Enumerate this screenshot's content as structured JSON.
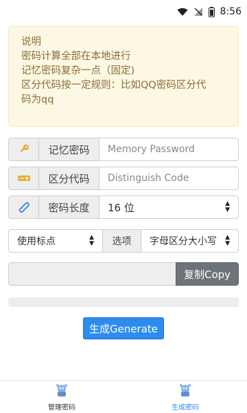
{
  "status_bar": {
    "time": "8:56"
  },
  "notice": {
    "lines": [
      "说明",
      "密码计算全部在本地进行",
      "记忆密码复杂一点（固定)",
      "区分代码按一定规则：比如QQ密码区分代",
      "码为qq"
    ]
  },
  "memory": {
    "label": "记忆密码",
    "placeholder": "Memory Password",
    "icon": "key-icon"
  },
  "code": {
    "label": "区分代码",
    "placeholder": "Distinguish Code",
    "icon": "ticket-icon"
  },
  "length": {
    "label": "密码长度",
    "value": "16 位",
    "icon": "ruler-icon"
  },
  "punct": {
    "value": "使用标点"
  },
  "options": {
    "label": "选项",
    "value": "字母区分大小写"
  },
  "copy_button": "复制Copy",
  "generate_button": "生成Generate",
  "tabs": [
    {
      "label": "管理密码",
      "active": false,
      "icon": "robot-icon"
    },
    {
      "label": "生成密码",
      "active": true,
      "icon": "robot-icon"
    }
  ],
  "colors": {
    "accent": "#2d8cf0",
    "notice_bg": "#fcf8e3",
    "notice_text": "#8a6d3b"
  }
}
